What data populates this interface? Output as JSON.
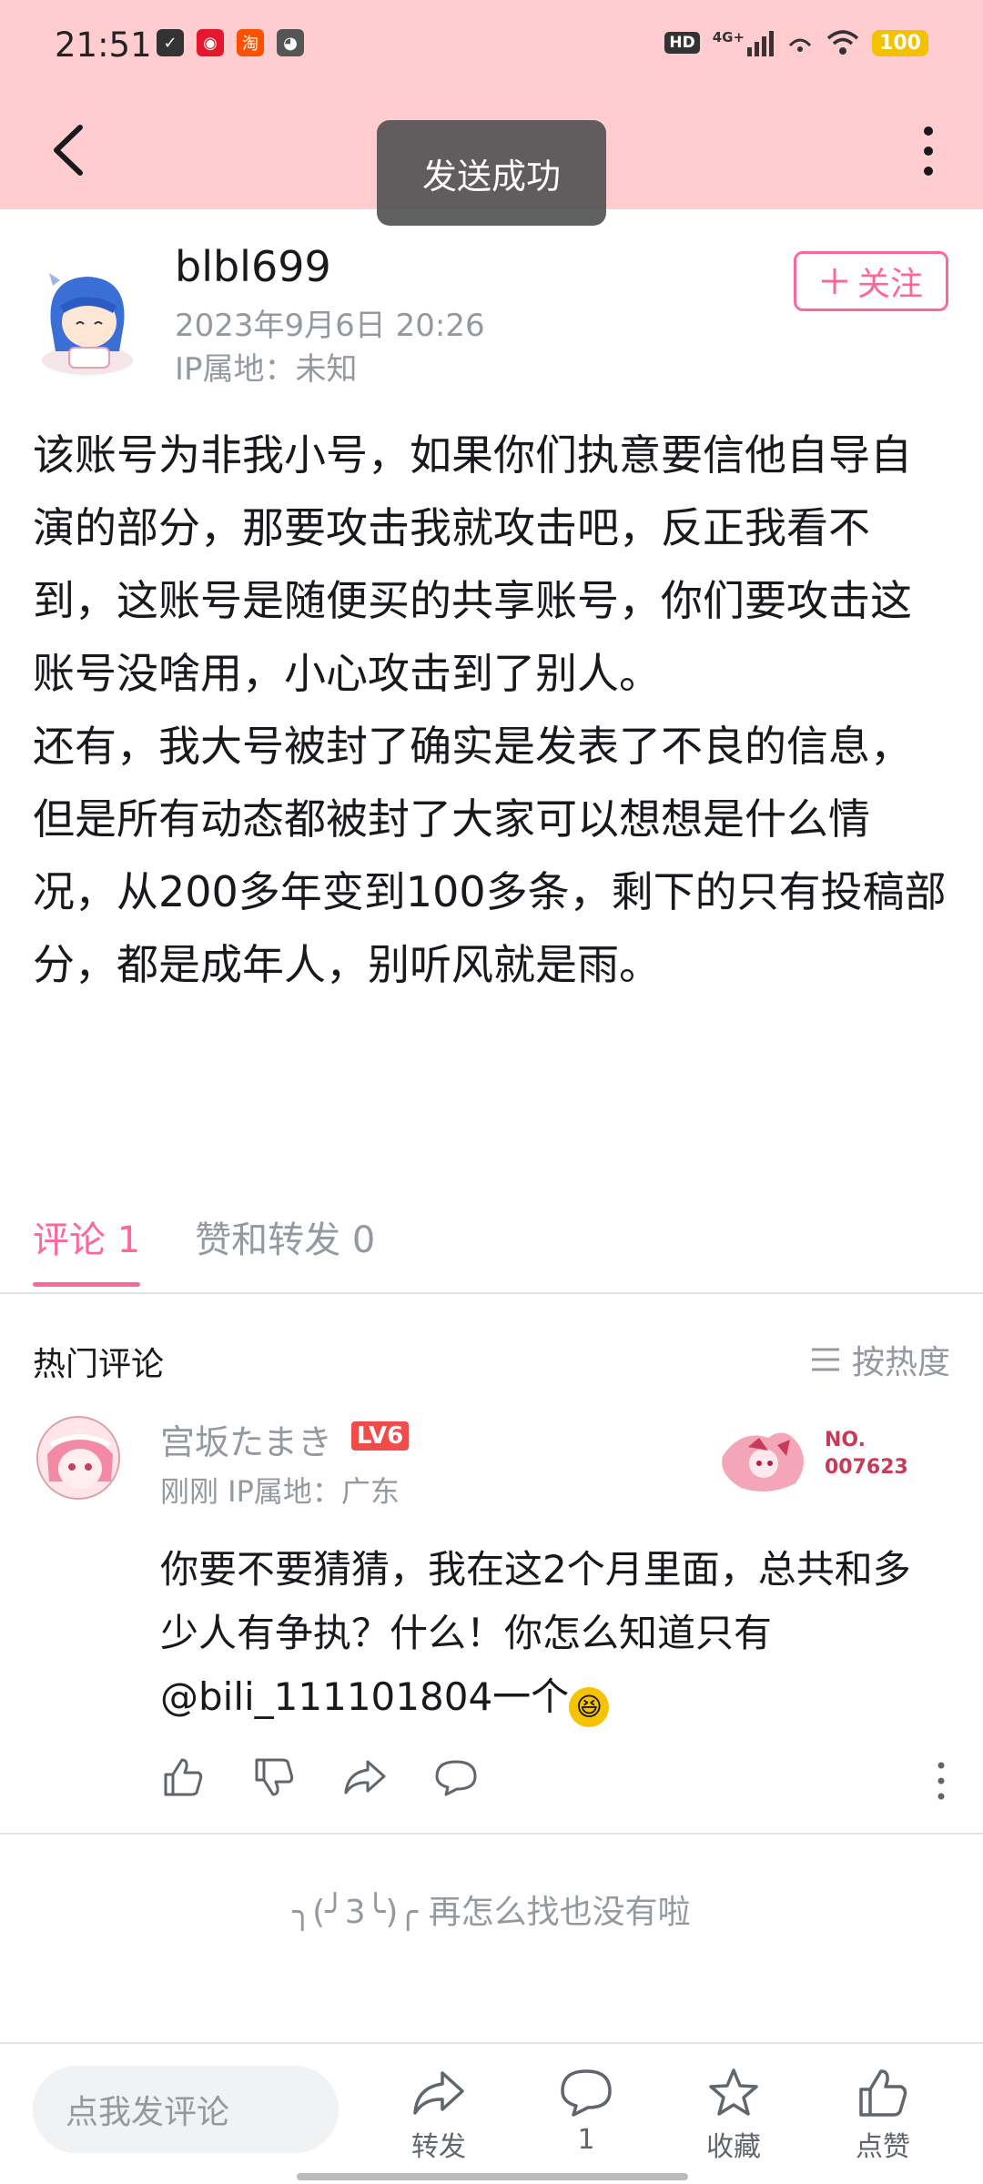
{
  "status_bar": {
    "time": "21:51",
    "network": "4G+",
    "battery": "100",
    "hd": "HD",
    "app_icons": [
      "clipboard-icon",
      "weibo-icon",
      "taobao-icon",
      "cat-icon"
    ]
  },
  "header": {
    "toast": "发送成功"
  },
  "author": {
    "name": "blbl699",
    "date": "2023年9月6日 20:26",
    "ip": "IP属地：未知",
    "follow_label": "关注"
  },
  "post": {
    "body": "该账号为非我小号，如果你们执意要信他自导自演的部分，那要攻击我就攻击吧，反正我看不到，这账号是随便买的共享账号，你们要攻击这账号没啥用，小心攻击到了别人。\n还有，我大号被封了确实是发表了不良的信息，但是所有动态都被封了大家可以想想是什么情况，从200多年变到100多条，剩下的只有投稿部分，都是成年人，别听风就是雨。"
  },
  "tabs": {
    "comments": "评论 1",
    "likes_reposts": "赞和转发 0"
  },
  "comments_section": {
    "title": "热门评论",
    "sort_label": "按热度",
    "comment": {
      "user": "宫坂たまき",
      "level": "LV6",
      "meta": "刚刚  IP属地：广东",
      "fan_no_label": "NO.",
      "fan_no": "007623",
      "text": "你要不要猜猜，我在这2个月里面，总共和多少人有争执？什么！你怎么知道只有@bili_111101804一个"
    },
    "end_prefix": "╮(╯3╰)╭",
    "end_message": "再怎么找也没有啦"
  },
  "bottom_bar": {
    "input_placeholder": "点我发评论",
    "repost_label": "转发",
    "comment_count": "1",
    "favorite_label": "收藏",
    "like_label": "点赞"
  },
  "colors": {
    "header_bg": "#ffcdd0",
    "accent": "#ff6699",
    "muted": "#9499a0"
  }
}
